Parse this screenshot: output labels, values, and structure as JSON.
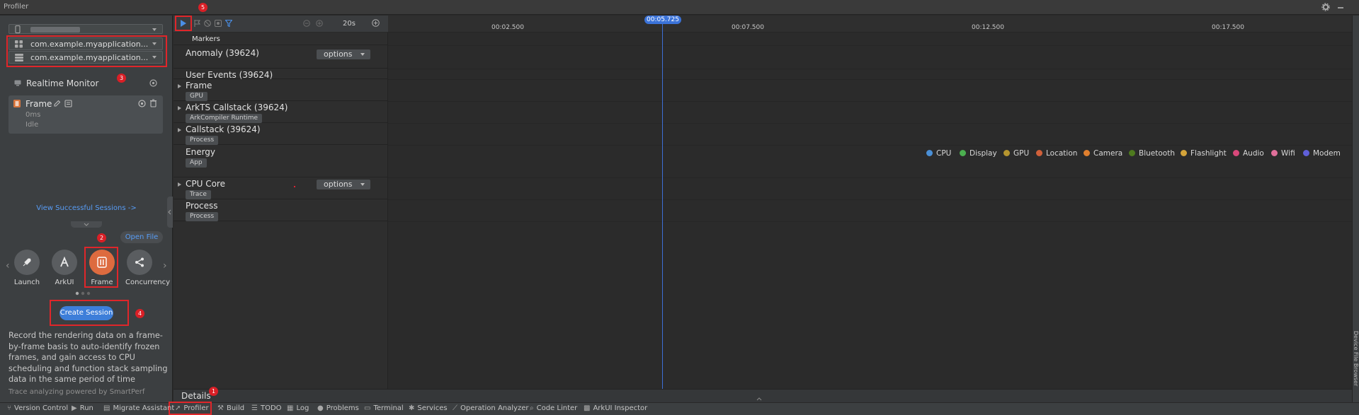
{
  "app": {
    "title": "Profiler"
  },
  "device": {
    "name": ""
  },
  "left": {
    "process_select_1": "com.example.myapplication...",
    "process_select_2": "com.example.myapplication...",
    "realtime_title": "Realtime Monitor",
    "frame_card": {
      "name": "Frame",
      "duration": "0ms",
      "status": "Idle"
    },
    "view_sessions": "View Successful Sessions ->",
    "open_file": "Open File",
    "tools": [
      {
        "label": "Launch",
        "icon": "rocket-icon"
      },
      {
        "label": "ArkUI",
        "icon": "arkui-icon"
      },
      {
        "label": "Frame",
        "icon": "frame-icon"
      },
      {
        "label": "Concurrency",
        "icon": "concurrency-icon"
      }
    ],
    "create_session": "Create Session",
    "description": "Record the rendering data on a frame-by-frame basis to auto-identify frozen frames, and gain access to CPU scheduling and function stack sampling data in the same period of time",
    "powered_by": "Trace analyzing powered by SmartPerf"
  },
  "annotations": {
    "b1": "1",
    "b2": "2",
    "b3": "3",
    "b4": "4",
    "b5": "5"
  },
  "toolbar": {
    "duration": "20s"
  },
  "tracks": {
    "markers": "Markers",
    "anomaly": "Anomaly (39624)",
    "options_1": "options",
    "user_events": "User Events (39624)",
    "frame": "Frame",
    "frame_tag": "GPU",
    "arkts": "ArkTS Callstack (39624)",
    "arkts_tag": "ArkCompiler Runtime",
    "callstack": "Callstack (39624)",
    "callstack_tag": "Process",
    "energy": "Energy",
    "energy_tag": "App",
    "cpu_core": "CPU Core",
    "options_2": "options",
    "cpu_tag": "Trace",
    "process": "Process",
    "process_tag": "Process"
  },
  "timeline": {
    "cursor_time": "00:05.725",
    "ticks": [
      "00:02.500",
      "00:07.500",
      "00:12.500",
      "00:17.500"
    ]
  },
  "legend": [
    {
      "label": "CPU",
      "color": "#4a8fd6"
    },
    {
      "label": "Display",
      "color": "#4caf50"
    },
    {
      "label": "GPU",
      "color": "#b5952f"
    },
    {
      "label": "Location",
      "color": "#d0603a"
    },
    {
      "label": "Camera",
      "color": "#e07f2e"
    },
    {
      "label": "Bluetooth",
      "color": "#4e7a1e"
    },
    {
      "label": "Flashlight",
      "color": "#d4a43a"
    },
    {
      "label": "Audio",
      "color": "#d8487a"
    },
    {
      "label": "Wifi",
      "color": "#e06f9a"
    },
    {
      "label": "Modem",
      "color": "#5f5fd9"
    }
  ],
  "details": "Details",
  "right_strip": "Device File Browser",
  "statusbar": [
    {
      "label": "Version Control",
      "icon": "branch-icon"
    },
    {
      "label": "Run",
      "icon": "run-icon"
    },
    {
      "label": "Migrate Assistant",
      "icon": "migrate-icon"
    },
    {
      "label": "Profiler",
      "icon": "profiler-icon"
    },
    {
      "label": "Build",
      "icon": "hammer-icon"
    },
    {
      "label": "TODO",
      "icon": "list-icon"
    },
    {
      "label": "Log",
      "icon": "log-icon"
    },
    {
      "label": "Problems",
      "icon": "info-icon"
    },
    {
      "label": "Terminal",
      "icon": "terminal-icon"
    },
    {
      "label": "Services",
      "icon": "services-icon"
    },
    {
      "label": "Operation Analyzer",
      "icon": "chart-icon"
    },
    {
      "label": "Code Linter",
      "icon": "linter-icon"
    },
    {
      "label": "ArkUI Inspector",
      "icon": "inspector-icon"
    }
  ]
}
